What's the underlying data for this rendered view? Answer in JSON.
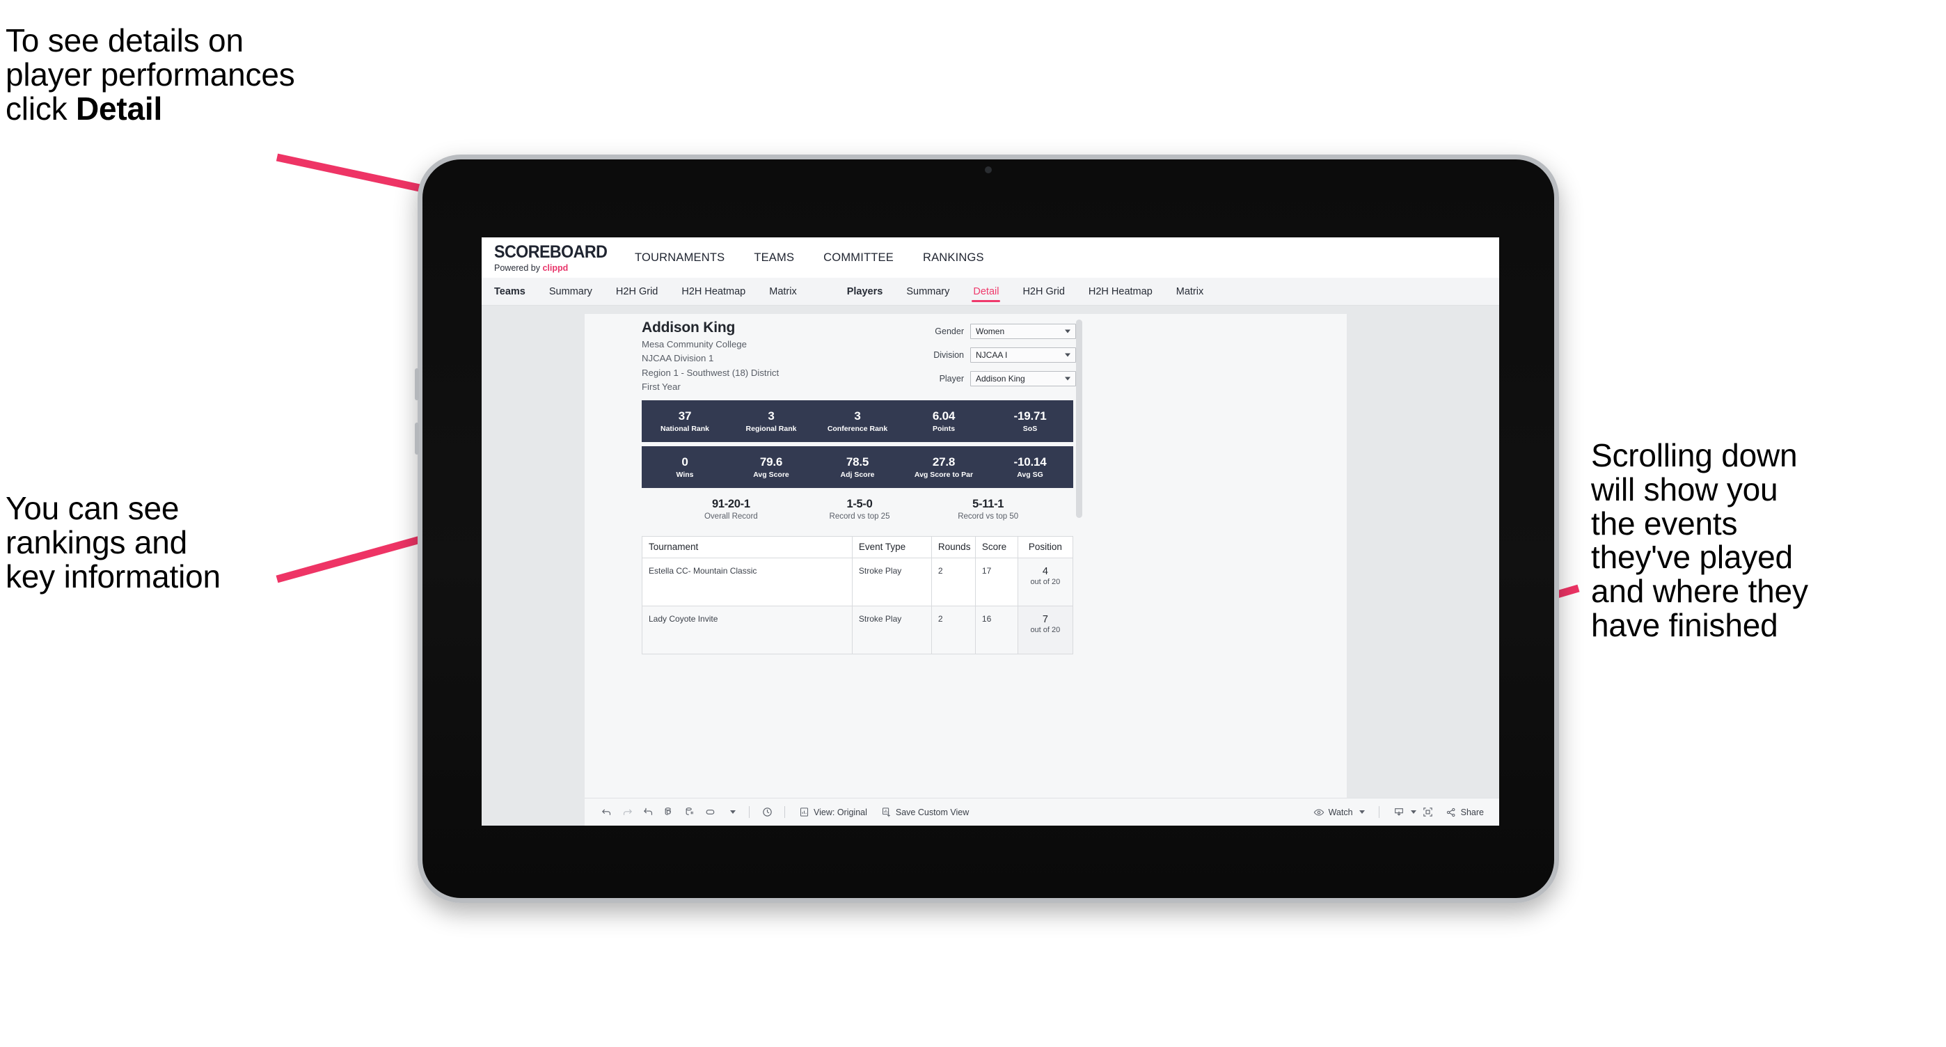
{
  "annotations": {
    "top_left": "To see details on\nplayer performances\nclick ",
    "top_left_bold": "Detail",
    "mid_left": "You can see\nrankings and\nkey information",
    "right": "Scrolling down\nwill show you\nthe events\nthey've played\nand where they\nhave finished",
    "arrow_color": "#ee3465"
  },
  "app": {
    "brand": {
      "name": "SCOREBOARD",
      "powered_prefix": "Powered by ",
      "powered_brand": "clippd"
    },
    "top_nav": [
      "TOURNAMENTS",
      "TEAMS",
      "COMMITTEE",
      "RANKINGS"
    ],
    "tabs_teams": [
      "Teams",
      "Summary",
      "H2H Grid",
      "H2H Heatmap",
      "Matrix"
    ],
    "tabs_players": [
      "Players",
      "Summary",
      "Detail",
      "H2H Grid",
      "H2H Heatmap",
      "Matrix"
    ],
    "active_tab": "Detail",
    "accent_color": "#ef3a6c"
  },
  "player": {
    "name": "Addison King",
    "school": "Mesa Community College",
    "division": "NJCAA Division 1",
    "region": "Region 1 - Southwest (18) District",
    "year": "First Year"
  },
  "filters": [
    {
      "label": "Gender",
      "value": "Women"
    },
    {
      "label": "Division",
      "value": "NJCAA I"
    },
    {
      "label": "Player",
      "value": "Addison King"
    }
  ],
  "stats_row_1": [
    {
      "value": "37",
      "label": "National Rank"
    },
    {
      "value": "3",
      "label": "Regional Rank"
    },
    {
      "value": "3",
      "label": "Conference Rank"
    },
    {
      "value": "6.04",
      "label": "Points"
    },
    {
      "value": "-19.71",
      "label": "SoS"
    }
  ],
  "stats_row_2": [
    {
      "value": "0",
      "label": "Wins"
    },
    {
      "value": "79.6",
      "label": "Avg Score"
    },
    {
      "value": "78.5",
      "label": "Adj Score"
    },
    {
      "value": "27.8",
      "label": "Avg Score to Par"
    },
    {
      "value": "-10.14",
      "label": "Avg SG"
    }
  ],
  "records": [
    {
      "value": "91-20-1",
      "label": "Overall Record"
    },
    {
      "value": "1-5-0",
      "label": "Record vs top 25"
    },
    {
      "value": "5-11-1",
      "label": "Record vs top 50"
    }
  ],
  "events_table": {
    "headers": [
      "Tournament",
      "Event Type",
      "Rounds",
      "Score",
      "Position"
    ],
    "rows": [
      {
        "tournament": "Estella CC- Mountain Classic",
        "event_type": "Stroke Play",
        "rounds": "2",
        "score": "17",
        "position": "4",
        "position_out_of": "out of 20"
      },
      {
        "tournament": "Lady Coyote Invite",
        "event_type": "Stroke Play",
        "rounds": "2",
        "score": "16",
        "position": "7",
        "position_out_of": "out of 20"
      }
    ]
  },
  "toolbar": {
    "view_label": "View: Original",
    "save_label": "Save Custom View",
    "watch_label": "Watch",
    "share_label": "Share"
  }
}
